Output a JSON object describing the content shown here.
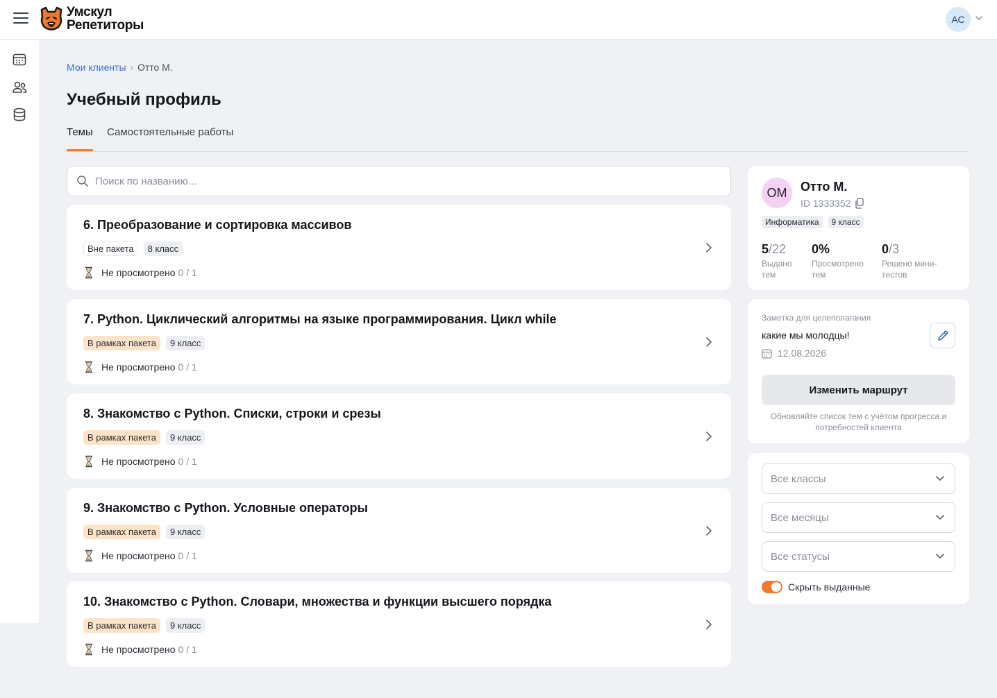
{
  "brand": {
    "line1": "Умскул",
    "line2": "Репетиторы"
  },
  "user": {
    "initials": "АС"
  },
  "breadcrumb": {
    "parent": "Мои клиенты",
    "current": "Отто М."
  },
  "page_title": "Учебный профиль",
  "tabs": [
    {
      "label": "Темы",
      "active": true
    },
    {
      "label": "Самостоятельные работы",
      "active": false
    }
  ],
  "search": {
    "placeholder": "Поиск по названию..."
  },
  "topics": [
    {
      "title": "6. Преобразование и сортировка массивов",
      "package": "Вне пакета",
      "package_type": "out",
      "grade": "8 класс",
      "status": "Не просмотрено",
      "count": "0 / 1"
    },
    {
      "title": "7. Python. Циклический алгоритмы на языке программирования. Цикл while",
      "package": "В рамках пакета",
      "package_type": "in",
      "grade": "9 класс",
      "status": "Не просмотрено",
      "count": "0 / 1"
    },
    {
      "title": "8. Знакомство с Python. Списки, строки и срезы",
      "package": "В рамках пакета",
      "package_type": "in",
      "grade": "9 класс",
      "status": "Не просмотрено",
      "count": "0 / 1"
    },
    {
      "title": "9. Знакомство с Python. Условные операторы",
      "package": "В рамках пакета",
      "package_type": "in",
      "grade": "9 класс",
      "status": "Не просмотрено",
      "count": "0 / 1"
    },
    {
      "title": "10. Знакомство с Python. Словари, множества и функции высшего порядка",
      "package": "В рамках пакета",
      "package_type": "in",
      "grade": "9 класс",
      "status": "Не просмотрено",
      "count": "0 / 1"
    }
  ],
  "client": {
    "initials": "ОМ",
    "name": "Отто М.",
    "id": "ID 1333352",
    "subject": "Информатика",
    "grade": "9 класс",
    "stats": [
      {
        "value": "5",
        "total": "/22",
        "label": "Выдано тем"
      },
      {
        "value": "0%",
        "total": "",
        "label": "Просмотрено тем"
      },
      {
        "value": "0",
        "total": "/3",
        "label": "Решено мини-тестов"
      }
    ]
  },
  "note": {
    "caption": "Заметка для целеполагания",
    "text": "какие мы молодцы!",
    "date": "12.08.2026",
    "route_button": "Изменить маршрут",
    "route_hint": "Обновляйте список тем с учётом прогресса и потребностей клиента"
  },
  "filters": {
    "classes": "Все классы",
    "months": "Все месяцы",
    "statuses": "Все статусы",
    "hide_issued_label": "Скрыть выданные",
    "hide_issued": true
  },
  "colors": {
    "accent": "#f07a2b",
    "link": "#3b6fd3",
    "package_in_bg": "#fde3c7"
  }
}
